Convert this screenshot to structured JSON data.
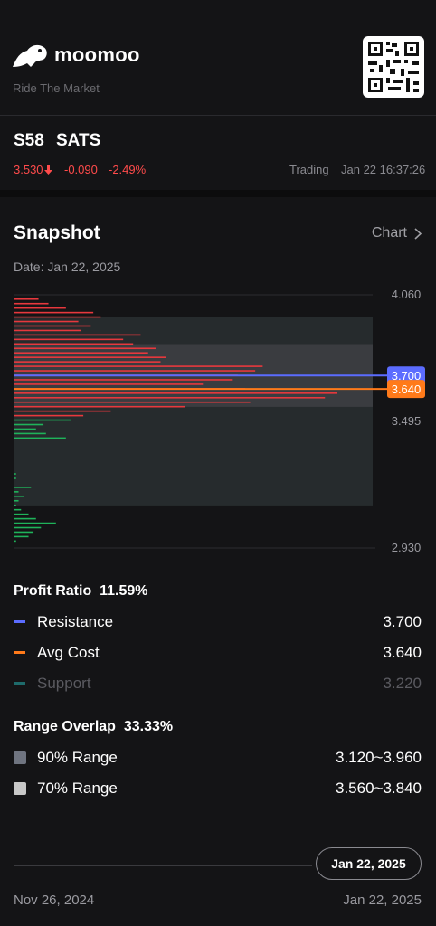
{
  "brand": {
    "name": "moomoo",
    "tagline": "Ride The Market"
  },
  "stock": {
    "code": "S58",
    "name": "SATS",
    "price": "3.530",
    "change": "-0.090",
    "change_pct": "-2.49%",
    "trading_status": "Trading",
    "timestamp": "Jan 22 16:37:26"
  },
  "snapshot": {
    "title": "Snapshot",
    "chart_link": "Chart",
    "date_line": "Date: Jan 22, 2025"
  },
  "chart_data": {
    "type": "bar",
    "orientation": "horizontal",
    "y_ticks": [
      "4.060",
      "3.495",
      "2.930"
    ],
    "ylim": [
      2.93,
      4.06
    ],
    "markers": [
      {
        "name": "Resistance",
        "value": "3.700",
        "color": "#5b6cff"
      },
      {
        "name": "Avg Cost",
        "value": "3.640",
        "color": "#ff7a1a"
      }
    ],
    "range_90": [
      3.12,
      3.96
    ],
    "range_70": [
      3.56,
      3.84
    ],
    "profit_color": "#e8383d",
    "loss_color": "#1fb35a",
    "red_bars": [
      {
        "price": 4.04,
        "len": 0.1
      },
      {
        "price": 4.02,
        "len": 0.14
      },
      {
        "price": 4.0,
        "len": 0.21
      },
      {
        "price": 3.98,
        "len": 0.32
      },
      {
        "price": 3.96,
        "len": 0.35
      },
      {
        "price": 3.94,
        "len": 0.26
      },
      {
        "price": 3.92,
        "len": 0.31
      },
      {
        "price": 3.9,
        "len": 0.27
      },
      {
        "price": 3.88,
        "len": 0.51
      },
      {
        "price": 3.86,
        "len": 0.44
      },
      {
        "price": 3.84,
        "len": 0.48
      },
      {
        "price": 3.82,
        "len": 0.57
      },
      {
        "price": 3.8,
        "len": 0.54
      },
      {
        "price": 3.78,
        "len": 0.61
      },
      {
        "price": 3.76,
        "len": 0.59
      },
      {
        "price": 3.74,
        "len": 1.0
      },
      {
        "price": 3.72,
        "len": 0.97
      },
      {
        "price": 3.7,
        "len": 0.9
      },
      {
        "price": 3.68,
        "len": 0.88
      },
      {
        "price": 3.66,
        "len": 0.76
      },
      {
        "price": 3.64,
        "len": 0.93
      },
      {
        "price": 3.62,
        "len": 1.3
      },
      {
        "price": 3.6,
        "len": 1.25
      },
      {
        "price": 3.58,
        "len": 0.95
      },
      {
        "price": 3.56,
        "len": 0.69
      },
      {
        "price": 3.54,
        "len": 0.39
      },
      {
        "price": 3.52,
        "len": 0.28
      }
    ],
    "green_bars": [
      {
        "price": 3.5,
        "len": 0.23
      },
      {
        "price": 3.48,
        "len": 0.12
      },
      {
        "price": 3.46,
        "len": 0.09
      },
      {
        "price": 3.44,
        "len": 0.13
      },
      {
        "price": 3.42,
        "len": 0.21
      },
      {
        "price": 3.26,
        "len": 0.01
      },
      {
        "price": 3.24,
        "len": 0.01
      },
      {
        "price": 3.2,
        "len": 0.07
      },
      {
        "price": 3.18,
        "len": 0.02
      },
      {
        "price": 3.16,
        "len": 0.04
      },
      {
        "price": 3.14,
        "len": 0.02
      },
      {
        "price": 3.12,
        "len": 0.01
      },
      {
        "price": 3.1,
        "len": 0.03
      },
      {
        "price": 3.08,
        "len": 0.06
      },
      {
        "price": 3.06,
        "len": 0.09
      },
      {
        "price": 3.04,
        "len": 0.17
      },
      {
        "price": 3.02,
        "len": 0.11
      },
      {
        "price": 3.0,
        "len": 0.08
      },
      {
        "price": 2.98,
        "len": 0.06
      },
      {
        "price": 2.96,
        "len": 0.01
      }
    ]
  },
  "profit": {
    "label": "Profit Ratio",
    "value": "11.59%",
    "rows": [
      {
        "label": "Resistance",
        "value": "3.700",
        "color": "#5b6cff"
      },
      {
        "label": "Avg Cost",
        "value": "3.640",
        "color": "#ff7a1a"
      },
      {
        "label": "Support",
        "value": "3.220",
        "color": "#1e6b6b"
      }
    ]
  },
  "range": {
    "label": "Range Overlap",
    "value": "33.33%",
    "rows": [
      {
        "label": "90% Range",
        "value": "3.120~3.960",
        "color": "#6f7480"
      },
      {
        "label": "70% Range",
        "value": "3.560~3.840",
        "color": "#c8c8c8"
      }
    ]
  },
  "timeline": {
    "start": "Nov 26, 2024",
    "end": "Jan 22, 2025",
    "selected": "Jan 22, 2025"
  }
}
